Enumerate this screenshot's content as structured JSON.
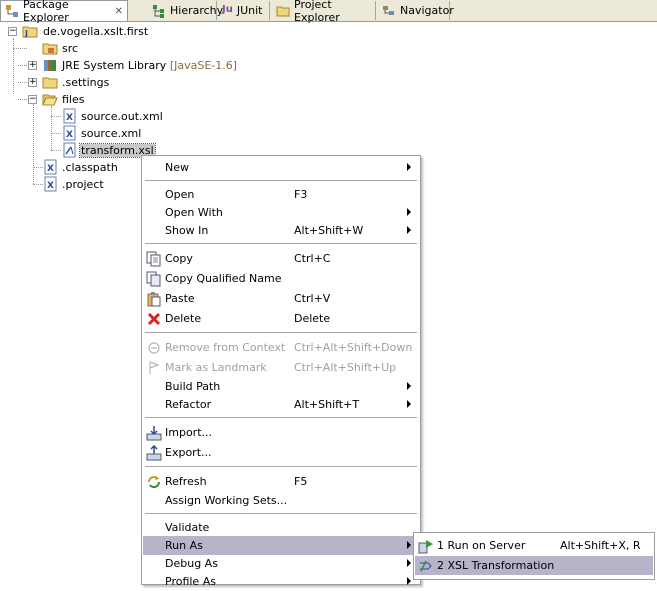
{
  "tabs": [
    {
      "label": "Package Explorer",
      "close": "✕",
      "icon": "package-explorer-icon",
      "active": true
    },
    {
      "label": "Hierarchy",
      "icon": "hierarchy-icon"
    },
    {
      "label": "JUnit",
      "icon_text": "Ju",
      "icon": "junit-icon"
    },
    {
      "label": "Project Explorer",
      "icon": "project-explorer-icon"
    },
    {
      "label": "Navigator",
      "icon": "navigator-icon"
    }
  ],
  "tree": {
    "project": "de.vogella.xslt.first",
    "src": "src",
    "jre": "JRE System Library",
    "jre_decor": "[JavaSE-1.6]",
    "settings": ".settings",
    "files": "files",
    "source_out": "source.out.xml",
    "source": "source.xml",
    "transform": "transform.xsl",
    "classpath": ".classpath",
    "project_file": ".project"
  },
  "menu": {
    "new": "New",
    "open": "Open",
    "open_sc": "F3",
    "open_with": "Open With",
    "show_in": "Show In",
    "show_in_sc": "Alt+Shift+W",
    "copy": "Copy",
    "copy_sc": "Ctrl+C",
    "copy_qn": "Copy Qualified Name",
    "paste": "Paste",
    "paste_sc": "Ctrl+V",
    "delete": "Delete",
    "delete_sc": "Delete",
    "remove_ctx": "Remove from Context",
    "remove_ctx_sc": "Ctrl+Alt+Shift+Down",
    "mark_landmark": "Mark as Landmark",
    "mark_landmark_sc": "Ctrl+Alt+Shift+Up",
    "build_path": "Build Path",
    "refactor": "Refactor",
    "refactor_sc": "Alt+Shift+T",
    "import": "Import...",
    "export": "Export...",
    "refresh": "Refresh",
    "refresh_sc": "F5",
    "assign_ws": "Assign Working Sets...",
    "validate": "Validate",
    "run_as": "Run As",
    "debug_as": "Debug As",
    "profile_as": "Profile As"
  },
  "submenu": {
    "run_server": "1 Run on Server",
    "run_server_sc": "Alt+Shift+X, R",
    "xsl_transform": "2 XSL Transformation"
  },
  "colors": {
    "tab_bg": "#ece9d8",
    "menu_highlight": "#b6b4c9",
    "disabled": "#a0a0a0",
    "folder": "#e8c55a",
    "xml_icon": "#2b4a9a"
  }
}
